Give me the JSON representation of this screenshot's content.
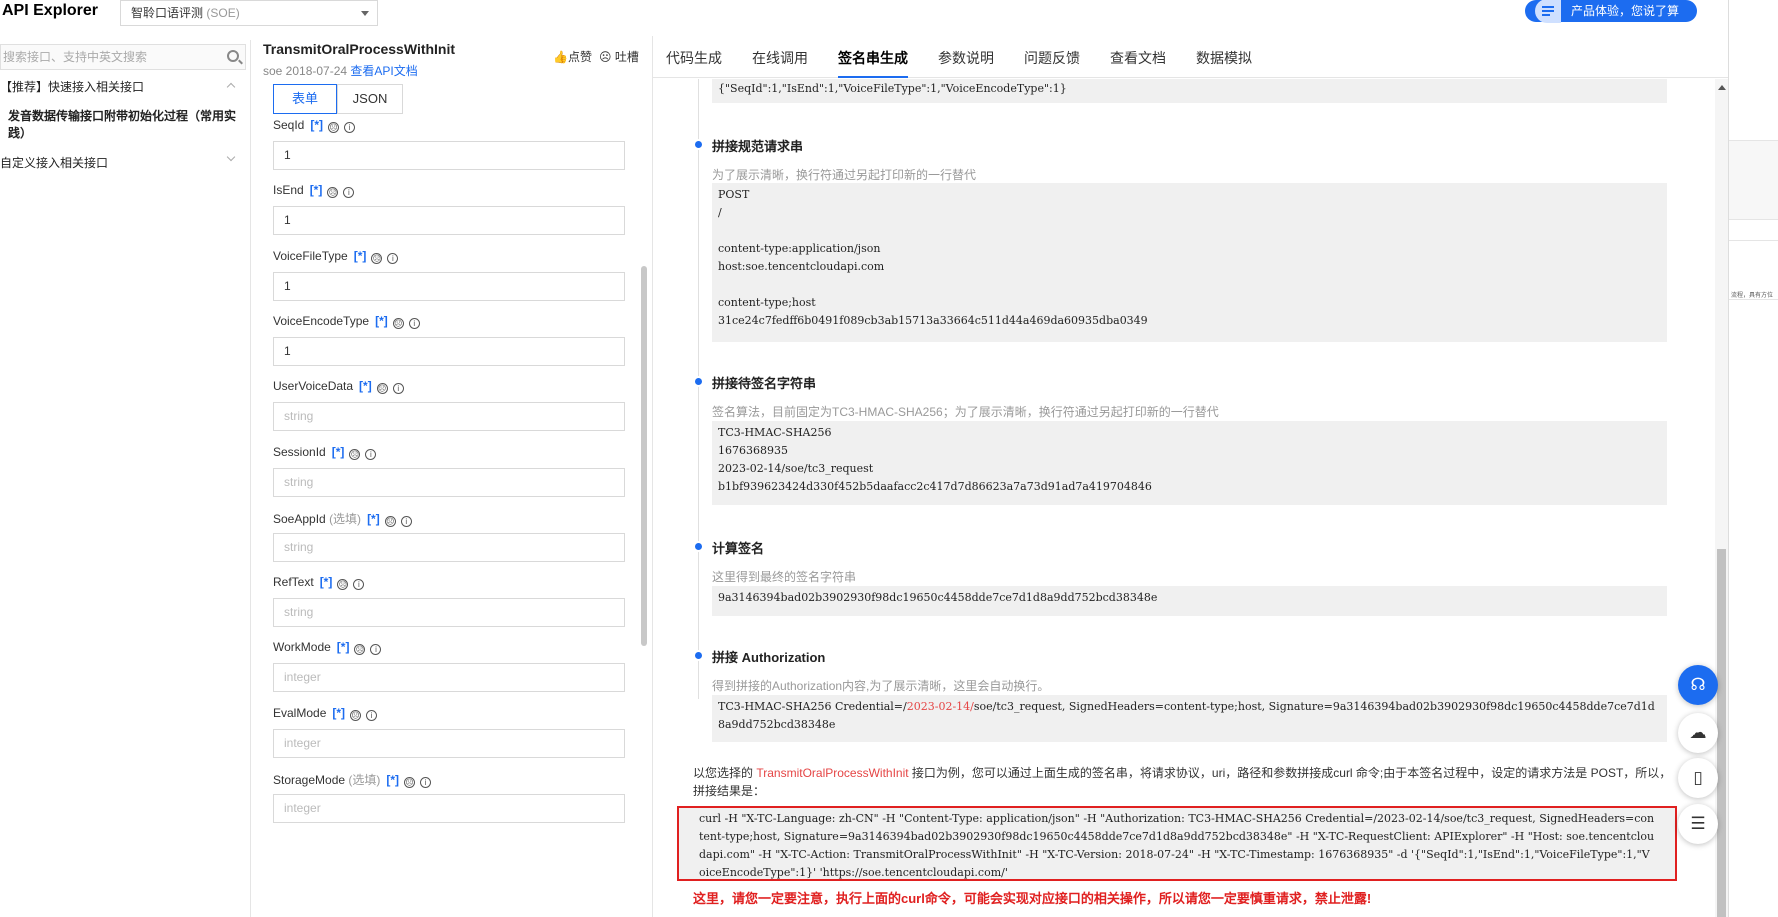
{
  "header": {
    "app_title": "API Explorer",
    "product_select": {
      "name": "智聆口语评测",
      "code": "(SOE)"
    },
    "promo_button": "产品体验，您说了算"
  },
  "sidebar": {
    "search_placeholder": "搜索接口、支持中英文搜索",
    "groups": [
      {
        "label": "【推荐】快速接入相关接口"
      },
      {
        "label": "发音数据传输接口附带初始化过程（常用实践）"
      },
      {
        "label": "自定义接入相关接口"
      }
    ]
  },
  "api": {
    "name": "TransmitOralProcessWithInit",
    "meta": "soe 2018-07-24",
    "doc_link": "查看API文档",
    "like_label": "点赞",
    "dislike_label": "吐槽"
  },
  "form": {
    "mode_tabs": [
      "表单",
      "JSON"
    ],
    "required_mark": "[*]",
    "optional_note": "(选填)",
    "fields": [
      {
        "name": "SeqId",
        "value": "1",
        "placeholder": ""
      },
      {
        "name": "IsEnd",
        "value": "1",
        "placeholder": ""
      },
      {
        "name": "VoiceFileType",
        "value": "1",
        "placeholder": ""
      },
      {
        "name": "VoiceEncodeType",
        "value": "1",
        "placeholder": ""
      },
      {
        "name": "UserVoiceData",
        "value": "",
        "placeholder": "string"
      },
      {
        "name": "SessionId",
        "value": "",
        "placeholder": "string"
      },
      {
        "name": "SoeAppId",
        "value": "",
        "placeholder": "string",
        "optional": true
      },
      {
        "name": "RefText",
        "value": "",
        "placeholder": "string"
      },
      {
        "name": "WorkMode",
        "value": "",
        "placeholder": "integer"
      },
      {
        "name": "EvalMode",
        "value": "",
        "placeholder": "integer"
      },
      {
        "name": "StorageMode",
        "value": "",
        "placeholder": "integer",
        "optional": true
      }
    ]
  },
  "main": {
    "tabs": [
      "代码生成",
      "在线调用",
      "签名串生成",
      "参数说明",
      "问题反馈",
      "查看文档",
      "数据模拟"
    ],
    "active_tab": "签名串生成",
    "payload": "{\"SeqId\":1,\"IsEnd\":1,\"VoiceFileType\":1,\"VoiceEncodeType\":1}",
    "sections": [
      {
        "title": "拼接规范请求串",
        "desc": "为了展示清晰，换行符通过另起打印新的一行替代",
        "code": "POST\n/\n\ncontent-type:application/json\nhost:soe.tencentcloudapi.com\n\ncontent-type;host\n31ce24c7fedff6b0491f089cb3ab15713a33664c511d44a469da60935dba0349"
      },
      {
        "title": "拼接待签名字符串",
        "desc": "签名算法，目前固定为TC3-HMAC-SHA256；为了展示清晰，换行符通过另起打印新的一行替代",
        "code": "TC3-HMAC-SHA256\n1676368935\n2023-02-14/soe/tc3_request\nb1bf939623424d330f452b5daafacc2c417d7d86623a7a73d91ad7a419704846"
      },
      {
        "title": "计算签名",
        "desc": "这里得到最终的签名字符串",
        "code": "9a3146394bad02b3902930f98dc19650c4458dde7ce7d1d8a9dd752bcd38348e"
      },
      {
        "title": "拼接 Authorization",
        "desc": "得到拼接的Authorization内容,为了展示清晰，这里会自动换行。",
        "code_prefix": "TC3-HMAC-SHA256 Credential=/",
        "code_date": "2023-02-14/",
        "code_suffix": "soe/tc3_request, SignedHeaders=content-type;host, Signature=9a3146394bad02b3902930f98dc19650c4458dde7ce7d1d8a9dd752bcd38348e"
      }
    ],
    "explain_prefix": "以您选择的 ",
    "explain_api": "TransmitOralProcessWithInit",
    "explain_suffix": " 接口为例，您可以通过上面生成的签名串，将请求协议，uri，路径和参数拼接成curl 命令;由于本签名过程中，设定的请求方法是 POST，所以，拼接结果是：",
    "curl": "curl -H \"X-TC-Language: zh-CN\" -H \"Content-Type: application/json\" -H \"Authorization: TC3-HMAC-SHA256 Credential=/2023-02-14/soe/tc3_request, SignedHeaders=content-type;host, Signature=9a3146394bad02b3902930f98dc19650c4458dde7ce7d1d8a9dd752bcd38348e\" -H \"X-TC-RequestClient: APIExplorer\" -H \"Host: soe.tencentcloudapi.com\" -H \"X-TC-Action: TransmitOralProcessWithInit\" -H \"X-TC-Version: 2018-07-24\" -H \"X-TC-Timestamp: 1676368935\"  -d '{\"SeqId\":1,\"IsEnd\":1,\"VoiceFileType\":1,\"VoiceEncodeType\":1}' 'https://soe.tencentcloudapi.com/'",
    "warning": "这里，请您一定要注意，执行上面的curl命令，可能会实现对应接口的相关操作，所以请您一定要慎重请求，禁止泄露!"
  },
  "side_strip_text": "流程，具有方位",
  "colors": {
    "accent": "#1c6cf0",
    "danger": "#e02020"
  }
}
